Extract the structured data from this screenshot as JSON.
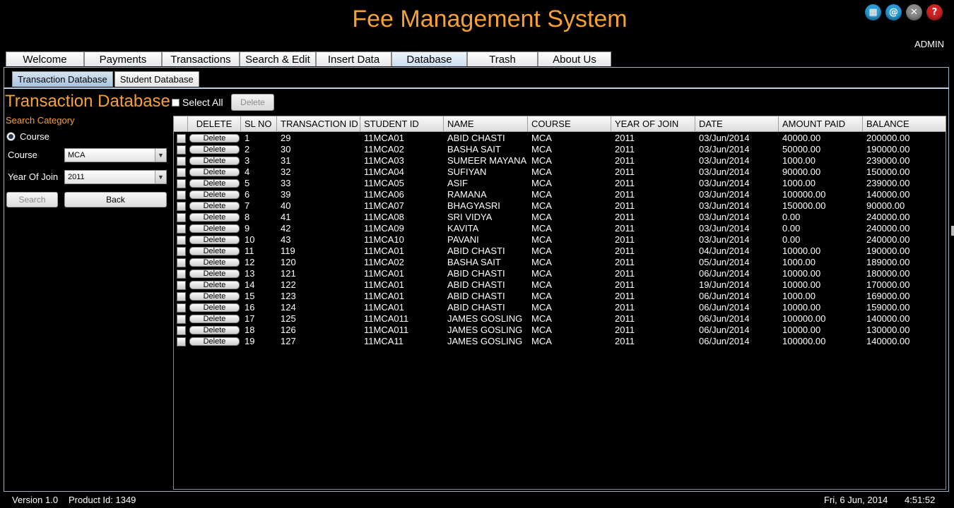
{
  "app": {
    "title": "Fee Management System",
    "user": "ADMIN"
  },
  "top_icons": [
    {
      "name": "grid-icon",
      "glyph": "▦"
    },
    {
      "name": "at-icon",
      "glyph": "@"
    },
    {
      "name": "close-icon",
      "glyph": "✕"
    },
    {
      "name": "help-icon",
      "glyph": "?"
    }
  ],
  "main_tabs": [
    {
      "label": "Welcome"
    },
    {
      "label": "Payments"
    },
    {
      "label": "Transactions"
    },
    {
      "label": "Search & Edit"
    },
    {
      "label": "Insert Data"
    },
    {
      "label": "Database",
      "active": true
    },
    {
      "label": "Trash"
    },
    {
      "label": "About Us"
    }
  ],
  "sub_tabs": [
    {
      "label": "Transaction Database",
      "active": true
    },
    {
      "label": "Student Database"
    }
  ],
  "section": {
    "title": "Transaction Database",
    "select_all_label": "Select All",
    "delete_label": "Delete"
  },
  "search": {
    "category_label": "Search Category",
    "radio_label": "Course",
    "course_label": "Course",
    "course_value": "MCA",
    "year_label": "Year Of Join",
    "year_value": "2011",
    "search_button": "Search",
    "back_button": "Back"
  },
  "table": {
    "columns": [
      "DELETE",
      "SL NO",
      "TRANSACTION ID",
      "STUDENT ID",
      "NAME",
      "COURSE",
      "YEAR OF JOIN",
      "DATE",
      "AMOUNT PAID",
      "BALANCE"
    ],
    "row_button_label": "Delete",
    "rows": [
      [
        "1",
        "29",
        "11MCA01",
        "ABID CHASTI",
        "MCA",
        "2011",
        "03/Jun/2014",
        "40000.00",
        "200000.00"
      ],
      [
        "2",
        "30",
        "11MCA02",
        "BASHA SAIT",
        "MCA",
        "2011",
        "03/Jun/2014",
        "50000.00",
        "190000.00"
      ],
      [
        "3",
        "31",
        "11MCA03",
        "SUMEER MAYANA",
        "MCA",
        "2011",
        "03/Jun/2014",
        "1000.00",
        "239000.00"
      ],
      [
        "4",
        "32",
        "11MCA04",
        "SUFIYAN",
        "MCA",
        "2011",
        "03/Jun/2014",
        "90000.00",
        "150000.00"
      ],
      [
        "5",
        "33",
        "11MCA05",
        "ASIF",
        "MCA",
        "2011",
        "03/Jun/2014",
        "1000.00",
        "239000.00"
      ],
      [
        "6",
        "39",
        "11MCA06",
        "RAMANA",
        "MCA",
        "2011",
        "03/Jun/2014",
        "100000.00",
        "140000.00"
      ],
      [
        "7",
        "40",
        "11MCA07",
        "BHAGYASRI",
        "MCA",
        "2011",
        "03/Jun/2014",
        "150000.00",
        "90000.00"
      ],
      [
        "8",
        "41",
        "11MCA08",
        "SRI VIDYA",
        "MCA",
        "2011",
        "03/Jun/2014",
        "0.00",
        "240000.00"
      ],
      [
        "9",
        "42",
        "11MCA09",
        "KAVITA",
        "MCA",
        "2011",
        "03/Jun/2014",
        "0.00",
        "240000.00"
      ],
      [
        "10",
        "43",
        "11MCA10",
        "PAVANI",
        "MCA",
        "2011",
        "03/Jun/2014",
        "0.00",
        "240000.00"
      ],
      [
        "11",
        "119",
        "11MCA01",
        "ABID CHASTI",
        "MCA",
        "2011",
        "04/Jun/2014",
        "10000.00",
        "190000.00"
      ],
      [
        "12",
        "120",
        "11MCA02",
        "BASHA SAIT",
        "MCA",
        "2011",
        "05/Jun/2014",
        "1000.00",
        "189000.00"
      ],
      [
        "13",
        "121",
        "11MCA01",
        "ABID CHASTI",
        "MCA",
        "2011",
        "06/Jun/2014",
        "10000.00",
        "180000.00"
      ],
      [
        "14",
        "122",
        "11MCA01",
        "ABID CHASTI",
        "MCA",
        "2011",
        "19/Jun/2014",
        "10000.00",
        "170000.00"
      ],
      [
        "15",
        "123",
        "11MCA01",
        "ABID CHASTI",
        "MCA",
        "2011",
        "06/Jun/2014",
        "1000.00",
        "169000.00"
      ],
      [
        "16",
        "124",
        "11MCA01",
        "ABID CHASTI",
        "MCA",
        "2011",
        "06/Jun/2014",
        "10000.00",
        "159000.00"
      ],
      [
        "17",
        "125",
        "11MCA011",
        "JAMES GOSLING",
        "MCA",
        "2011",
        "06/Jun/2014",
        "100000.00",
        "140000.00"
      ],
      [
        "18",
        "126",
        "11MCA011",
        "JAMES GOSLING",
        "MCA",
        "2011",
        "06/Jun/2014",
        "10000.00",
        "130000.00"
      ],
      [
        "19",
        "127",
        "11MCA11",
        "JAMES GOSLING",
        "MCA",
        "2011",
        "06/Jun/2014",
        "100000.00",
        "140000.00"
      ]
    ]
  },
  "status": {
    "version": "Version 1.0",
    "product": "Product Id: 1349",
    "date": "Fri, 6 Jun, 2014",
    "time": "4:51:52"
  }
}
